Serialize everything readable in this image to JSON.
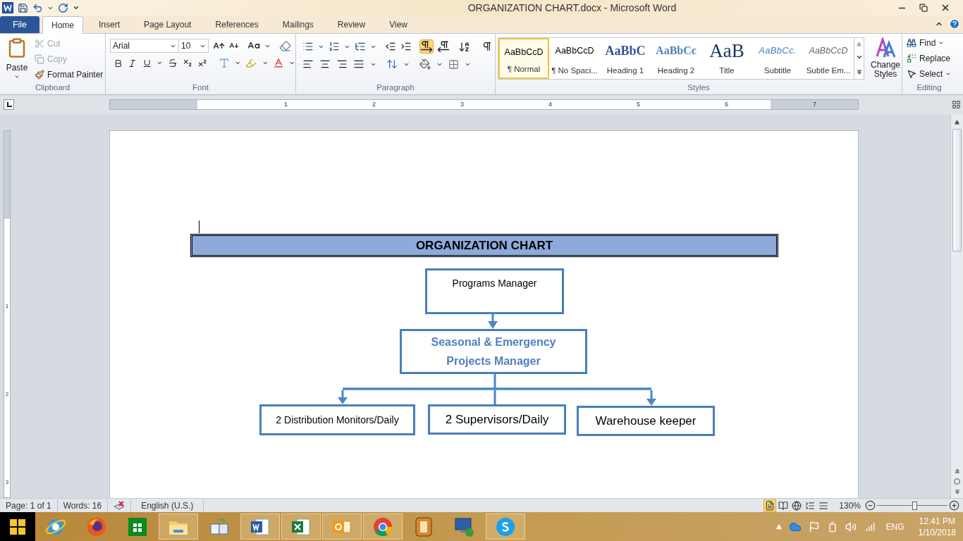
{
  "window": {
    "title": "ORGANIZATION CHART.docx - Microsoft Word"
  },
  "tabs": [
    {
      "label": "File",
      "kind": "backstage",
      "selected": false
    },
    {
      "label": "Home",
      "kind": "tab",
      "selected": true
    },
    {
      "label": "Insert",
      "kind": "tab",
      "selected": false
    },
    {
      "label": "Page Layout",
      "kind": "tab",
      "selected": false
    },
    {
      "label": "References",
      "kind": "tab",
      "selected": false
    },
    {
      "label": "Mailings",
      "kind": "tab",
      "selected": false
    },
    {
      "label": "Review",
      "kind": "tab",
      "selected": false
    },
    {
      "label": "View",
      "kind": "tab",
      "selected": false
    }
  ],
  "clipboard": {
    "title": "Clipboard",
    "paste": "Paste",
    "commands": [
      {
        "kind": "cut",
        "label": "Cut",
        "disabled": true
      },
      {
        "kind": "copy",
        "label": "Copy",
        "disabled": true
      },
      {
        "kind": "painter",
        "label": "Format Painter",
        "disabled": false
      }
    ]
  },
  "font": {
    "title": "Font",
    "name": "Arial",
    "size": "10"
  },
  "paragraph": {
    "title": "Paragraph",
    "toggles": [
      {
        "kind": "ltr",
        "selected": true
      },
      {
        "kind": "rtl",
        "selected": false
      }
    ]
  },
  "styles": {
    "title": "Styles",
    "items": [
      {
        "kind": "normal",
        "preview": "AaBbCcD",
        "label": "¶ Normal",
        "selected": true
      },
      {
        "kind": "normal",
        "preview": "AaBbCcD",
        "label": "¶ No Spaci...",
        "selected": false
      },
      {
        "kind": "heading1",
        "preview": "AaBbC",
        "label": "Heading 1",
        "selected": false
      },
      {
        "kind": "heading2",
        "preview": "AaBbCc",
        "label": "Heading 2",
        "selected": false
      },
      {
        "kind": "title",
        "preview": "AaB",
        "label": "Title",
        "selected": false
      },
      {
        "kind": "subtitle",
        "preview": "AaBbCc.",
        "label": "Subtitle",
        "selected": false
      },
      {
        "kind": "subtle",
        "preview": "AaBbCcD",
        "label": "Subtle Em...",
        "selected": false
      }
    ],
    "change_styles": "Change Styles"
  },
  "editing": {
    "title": "Editing",
    "find": "Find",
    "replace": "Replace",
    "select": "Select"
  },
  "ruler": {
    "marks": [
      "1",
      "2",
      "3",
      "4",
      "5",
      "6",
      "7"
    ]
  },
  "vertical_ruler": {
    "marks": [
      "1",
      "2",
      "3"
    ]
  },
  "document": {
    "heading": "ORGANIZATION CHART",
    "org_chart": {
      "label": "Programs Manager",
      "children": [
        {
          "label": "Seasonal & Emergency Projects Manager",
          "children": [
            {
              "label": "2 Distribution Monitors/Daily"
            },
            {
              "label": "2 Supervisors/Daily"
            },
            {
              "label": "Warehouse keeper"
            }
          ]
        }
      ]
    }
  },
  "status_bar": {
    "page": "Page: 1 of 1",
    "words": "Words: 16",
    "language": "English (U.S.)",
    "views": [
      {
        "kind": "print",
        "selected": true
      },
      {
        "kind": "reading",
        "selected": false
      },
      {
        "kind": "web",
        "selected": false
      },
      {
        "kind": "outline",
        "selected": false
      },
      {
        "kind": "draft",
        "selected": false
      }
    ],
    "zoom": "130%",
    "zoom_slider": {
      "level": 0.53
    }
  },
  "taskbar": {
    "apps": [
      {
        "kind": "ie",
        "running": false
      },
      {
        "kind": "firefox",
        "running": false
      },
      {
        "kind": "store",
        "running": false
      },
      {
        "kind": "explorer",
        "running": true
      },
      {
        "kind": "dictionary",
        "running": false
      },
      {
        "kind": "word",
        "running": true
      },
      {
        "kind": "excel",
        "running": true
      },
      {
        "kind": "outlook",
        "running": true
      },
      {
        "kind": "chrome",
        "running": true
      },
      {
        "kind": "notes",
        "running": false
      },
      {
        "kind": "remote",
        "running": false
      },
      {
        "kind": "skype",
        "running": true
      }
    ]
  },
  "tray": {
    "language": "ENG",
    "time": "12:41 PM",
    "date": "1/10/2018"
  }
}
